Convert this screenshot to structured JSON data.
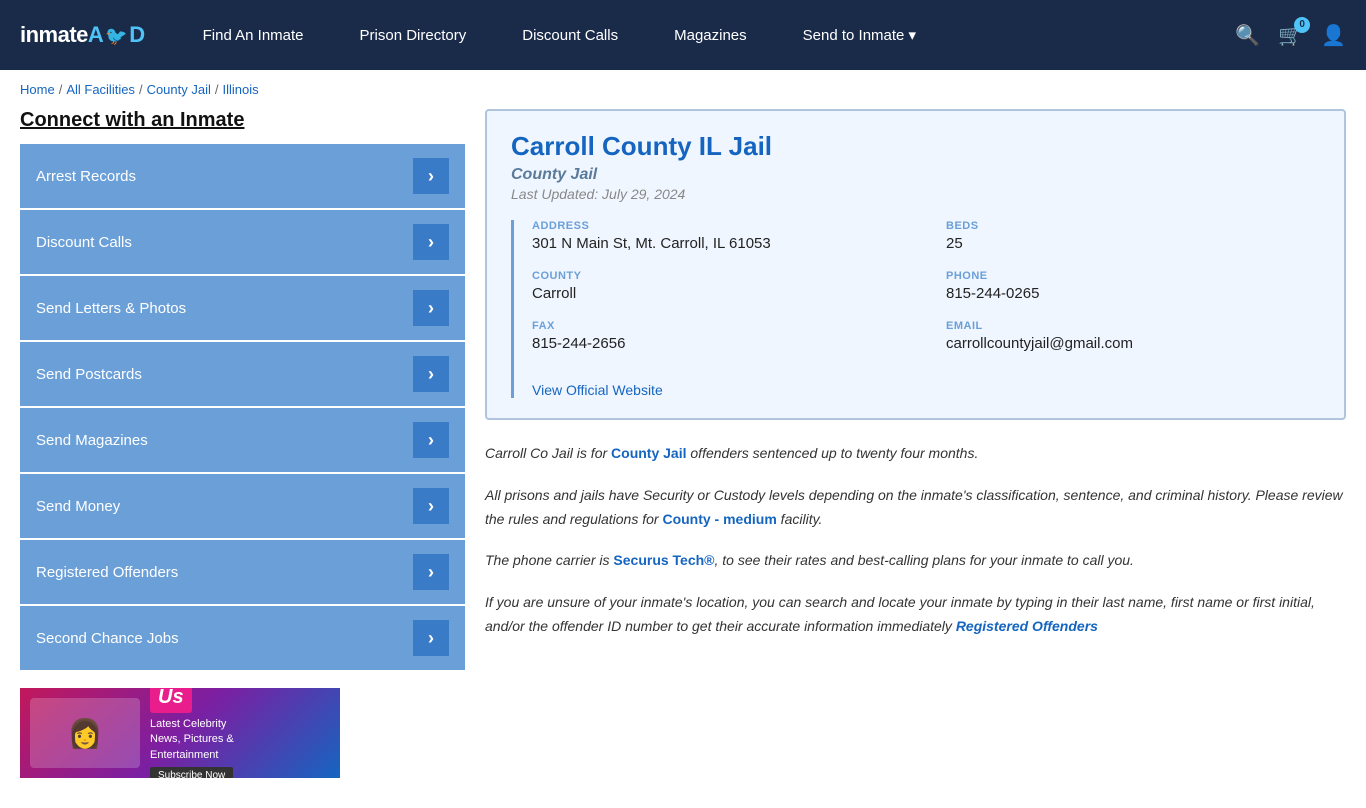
{
  "header": {
    "logo": "inmateAID",
    "cart_count": "0",
    "nav": [
      {
        "label": "Find An Inmate",
        "id": "find-inmate"
      },
      {
        "label": "Prison Directory",
        "id": "prison-directory"
      },
      {
        "label": "Discount Calls",
        "id": "discount-calls"
      },
      {
        "label": "Magazines",
        "id": "magazines"
      },
      {
        "label": "Send to Inmate ▾",
        "id": "send-to-inmate"
      }
    ]
  },
  "breadcrumb": {
    "items": [
      "Home",
      "All Facilities",
      "County Jail",
      "Illinois"
    ]
  },
  "sidebar": {
    "title": "Connect with an Inmate",
    "menu": [
      {
        "label": "Arrest Records"
      },
      {
        "label": "Discount Calls"
      },
      {
        "label": "Send Letters & Photos"
      },
      {
        "label": "Send Postcards"
      },
      {
        "label": "Send Magazines"
      },
      {
        "label": "Send Money"
      },
      {
        "label": "Registered Offenders"
      },
      {
        "label": "Second Chance Jobs"
      }
    ]
  },
  "facility": {
    "name": "Carroll County IL Jail",
    "type": "County Jail",
    "last_updated": "Last Updated: July 29, 2024",
    "address_label": "ADDRESS",
    "address": "301 N Main St, Mt. Carroll, IL 61053",
    "beds_label": "BEDS",
    "beds": "25",
    "county_label": "COUNTY",
    "county": "Carroll",
    "phone_label": "PHONE",
    "phone": "815-244-0265",
    "fax_label": "FAX",
    "fax": "815-244-2656",
    "email_label": "EMAIL",
    "email": "carrollcountyjail@gmail.com",
    "website_label": "View Official Website"
  },
  "description": {
    "p1_before": "Carroll Co Jail is for ",
    "p1_bold": "County Jail",
    "p1_after": " offenders sentenced up to twenty four months.",
    "p2": "All prisons and jails have Security or Custody levels depending on the inmate's classification, sentence, and criminal history. Please review the rules and regulations for ",
    "p2_bold": "County - medium",
    "p2_after": " facility.",
    "p3_before": "The phone carrier is ",
    "p3_bold": "Securus Tech®",
    "p3_after": ", to see their rates and best-calling plans for your inmate to call you.",
    "p4": "If you are unsure of your inmate's location, you can search and locate your inmate by typing in their last name, first name or first initial, and/or the offender ID number to get their accurate information immediately ",
    "p4_bold": "Registered Offenders"
  }
}
